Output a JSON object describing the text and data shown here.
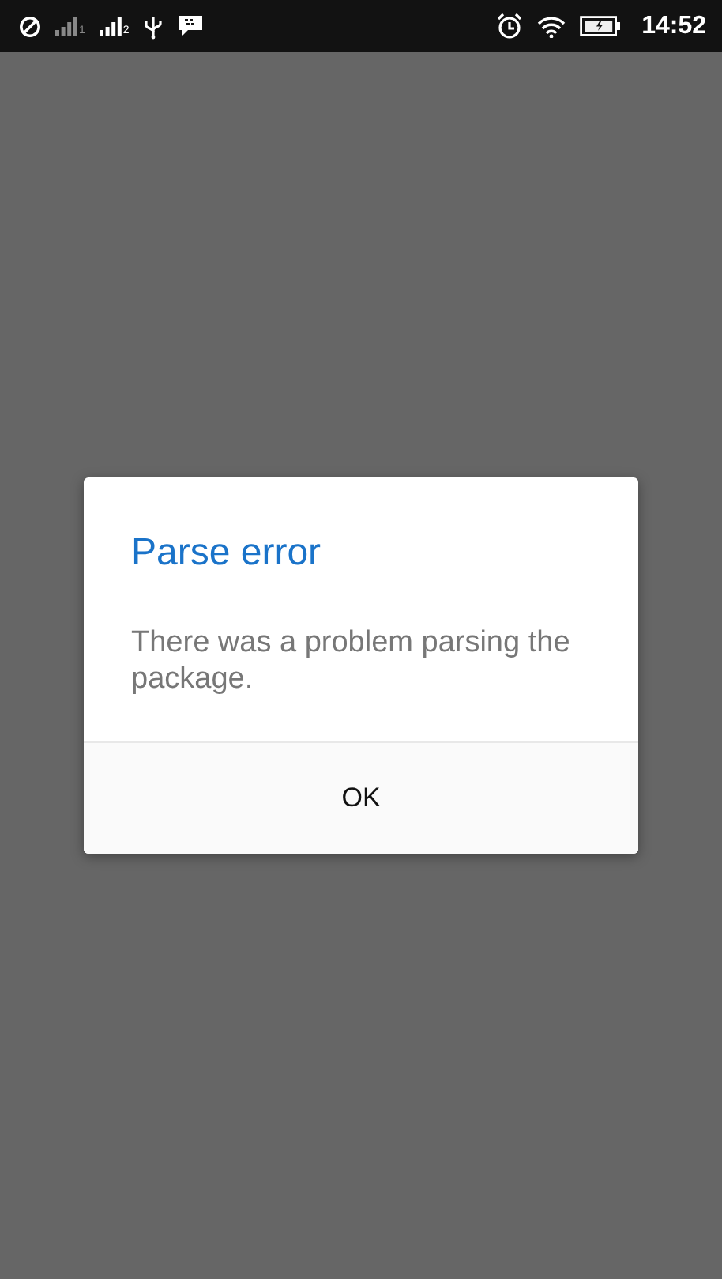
{
  "status_bar": {
    "sim_slots": [
      {
        "label": "1",
        "active": false
      },
      {
        "label": "2",
        "active": true
      }
    ],
    "time": "14:52"
  },
  "dialog": {
    "title": "Parse error",
    "message": "There was a problem parsing the package.",
    "buttons": [
      "OK"
    ]
  }
}
